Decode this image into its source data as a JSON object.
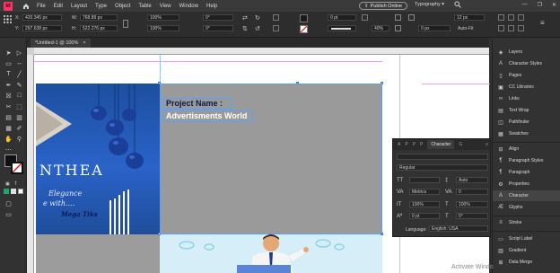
{
  "menubar": {
    "app_icon": "Id",
    "items": [
      "File",
      "Edit",
      "Layout",
      "Type",
      "Object",
      "Table",
      "View",
      "Window",
      "Help"
    ],
    "publish_label": "Publish Online",
    "workspace": "Typography",
    "window_controls": [
      "—",
      "❐",
      "✕"
    ]
  },
  "control": {
    "x_label": "X:",
    "x_value": "420.345 px",
    "y_label": "Y:",
    "y_value": "297.638 px",
    "w_label": "W:",
    "w_value": "768.89 px",
    "h_label": "H:",
    "h_value": "522.276 px",
    "scale_x": "100%",
    "scale_y": "100%",
    "rotate": "0°",
    "shear": "0°",
    "stroke_weight": "0 pt",
    "opacity": "40%",
    "ref_x": "0 px",
    "fit_size": "12 px",
    "auto_fit_label": "Auto-Fit"
  },
  "doc": {
    "tab_title": "*Untitled-1 @ 100%"
  },
  "canvas": {
    "brand": "NTHEA",
    "tagline_line1": "Elegance",
    "tagline_line2": "e with....",
    "signature": "Mega Tiks",
    "project_name": "Project Name :",
    "adv_world": "Advertisments World"
  },
  "character_panel": {
    "tabs": [
      "A",
      "P",
      "P",
      "P",
      "Character",
      "G"
    ],
    "active_tab": "Character",
    "font_family": "",
    "font_style": "Regular",
    "kerning": "Metrics",
    "leading": "Auto",
    "tracking": "0",
    "size": "",
    "vscale": "100%",
    "hscale": "100%",
    "baseline": "0 pt",
    "skew": "0°",
    "language_label": "Language:",
    "language_value": "English: USA"
  },
  "dock": {
    "items": [
      "Layers",
      "Character Styles",
      "Pages",
      "CC Libraries",
      "Links",
      "Text Wrap",
      "Pathfinder",
      "Swatches",
      "Align",
      "Paragraph Styles",
      "Paragraph",
      "Properties",
      "Character",
      "Glyphs",
      "Stroke",
      "Script Label",
      "Gradient",
      "Data Merge"
    ],
    "active": "Character"
  },
  "watermark": "Activate Windo"
}
